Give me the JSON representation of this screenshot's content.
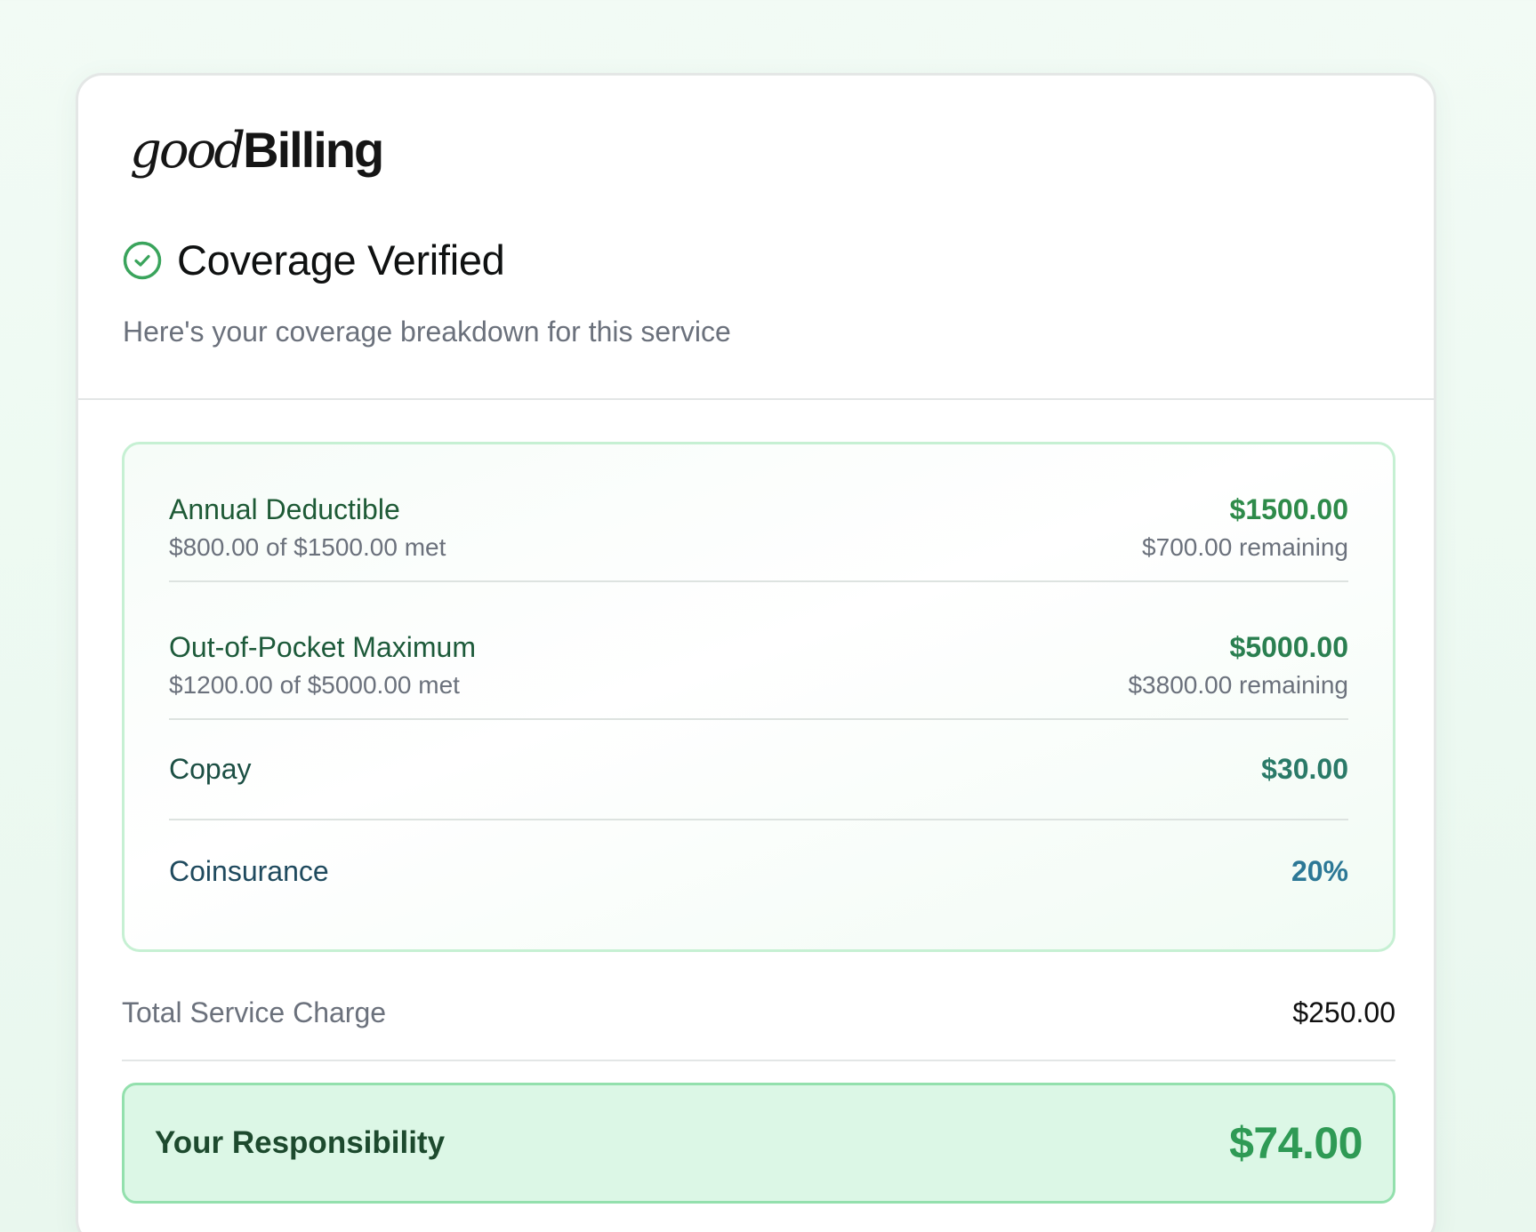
{
  "logo": {
    "good": "good",
    "billing": "Billing"
  },
  "header": {
    "title": "Coverage Verified",
    "subtitle": "Here's your coverage breakdown for this service",
    "status_icon": "check-circle-icon"
  },
  "breakdown": {
    "items": [
      {
        "label": "Annual Deductible",
        "detail": "$800.00 of $1500.00 met",
        "amount": "$1500.00",
        "remaining": "$700.00 remaining",
        "label_color": "#1e5a36",
        "amount_color": "#2e8b4a"
      },
      {
        "label": "Out-of-Pocket Maximum",
        "detail": "$1200.00 of $5000.00 met",
        "amount": "$5000.00",
        "remaining": "$3800.00 remaining",
        "label_color": "#1d5a3a",
        "amount_color": "#2a7f50"
      },
      {
        "label": "Copay",
        "amount": "$30.00",
        "label_color": "#1c4f44",
        "amount_color": "#2a7a68"
      },
      {
        "label": "Coinsurance",
        "amount": "20%",
        "label_color": "#1f4a5e",
        "amount_color": "#2c7896"
      }
    ]
  },
  "total": {
    "label": "Total Service Charge",
    "value": "$250.00"
  },
  "responsibility": {
    "label": "Your Responsibility",
    "value": "$74.00"
  },
  "colors": {
    "accent": "#2f9a55",
    "border_green": "#c6f0d3",
    "responsibility_bg": "#dcf7e6"
  }
}
